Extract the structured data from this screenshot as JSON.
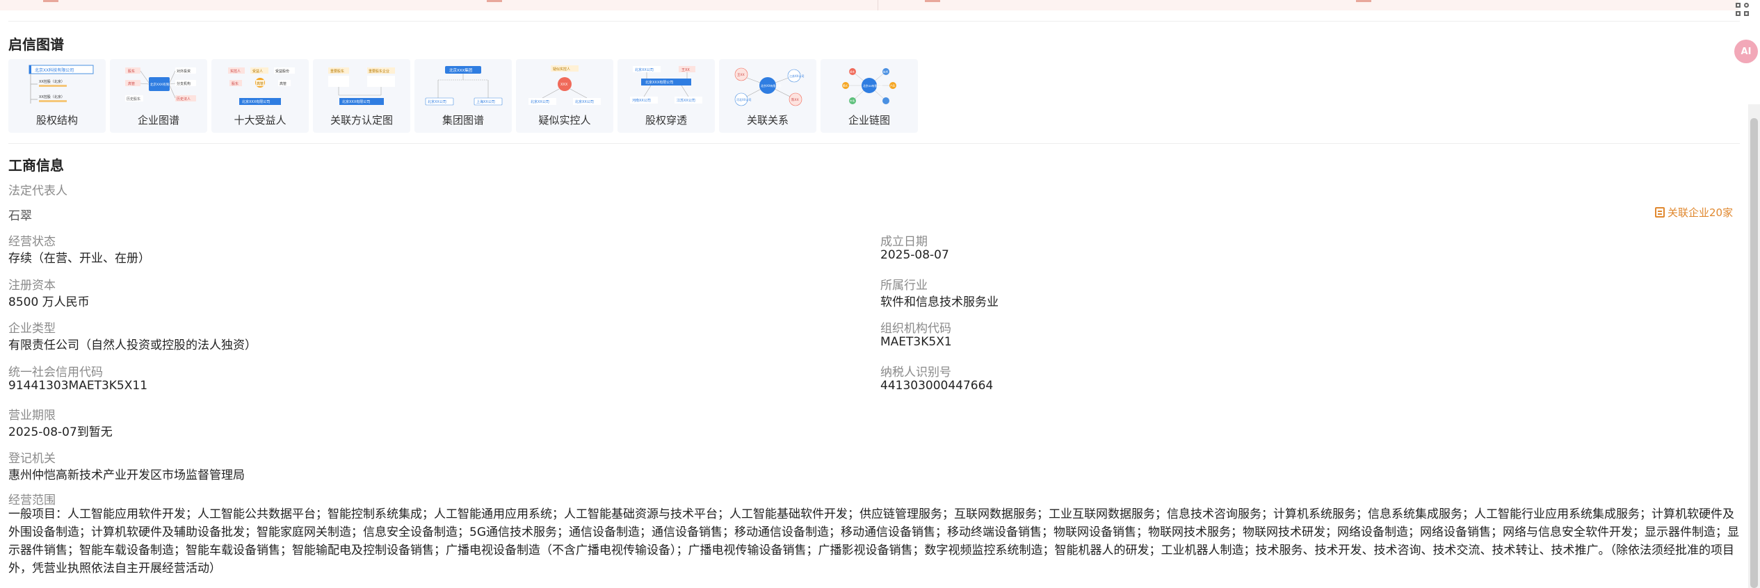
{
  "graphs": {
    "title": "启信图谱",
    "items": [
      {
        "label": "股权结构"
      },
      {
        "label": "企业图谱"
      },
      {
        "label": "十大受益人"
      },
      {
        "label": "关联方认定图"
      },
      {
        "label": "集团图谱"
      },
      {
        "label": "疑似实控人"
      },
      {
        "label": "股权穿透"
      },
      {
        "label": "关联关系"
      },
      {
        "label": "企业链图"
      }
    ]
  },
  "business": {
    "title": "工商信息",
    "legal_rep_label": "法定代表人",
    "legal_rep": "石翠",
    "related_companies": "关联企业20家",
    "status_label": "经营状态",
    "status": "存续（在营、开业、在册）",
    "founded_label": "成立日期",
    "founded": "2025-08-07",
    "capital_label": "注册资本",
    "capital": "8500 万人民币",
    "industry_label": "所属行业",
    "industry": "软件和信息技术服务业",
    "type_label": "企业类型",
    "type": "有限责任公司（自然人投资或控股的法人独资）",
    "org_code_label": "组织机构代码",
    "org_code": "MAET3K5X1",
    "credit_code_label": "统一社会信用代码",
    "credit_code": "91441303MAET3K5X11",
    "taxpayer_label": "纳税人识别号",
    "taxpayer": "441303000447664",
    "term_label": "营业期限",
    "term": "2025-08-07到暂无",
    "authority_label": "登记机关",
    "authority": "惠州仲恺高新技术产业开发区市场监督管理局",
    "scope_label": "经营范围",
    "scope": "一般项目：人工智能应用软件开发；人工智能公共数据平台；智能控制系统集成；人工智能通用应用系统；人工智能基础资源与技术平台；人工智能基础软件开发；供应链管理服务；互联网数据服务；工业互联网数据服务；信息技术咨询服务；计算机系统服务；信息系统集成服务；人工智能行业应用系统集成服务；计算机软硬件及外围设备制造；计算机软硬件及辅助设备批发；智能家庭网关制造；信息安全设备制造；5G通信技术服务；通信设备制造；通信设备销售；移动通信设备制造；移动通信设备销售；移动终端设备销售；物联网设备销售；物联网技术服务；物联网技术研发；网络设备制造；网络设备销售；网络与信息安全软件开发；显示器件制造；显示器件销售；智能车载设备制造；智能车载设备销售；智能输配电及控制设备销售；广播电视设备制造（不含广播电视传输设备）；广播电视传输设备销售；广播影视设备销售；数字视频监控系统制造；智能机器人的研发；工业机器人制造；技术服务、技术开发、技术咨询、技术交流、技术转让、技术推广。（除依法须经批准的项目外，凭营业执照依法自主开展经营活动）"
  },
  "side": {
    "avatar_text": "AI"
  },
  "thumb_text": {
    "t1": [
      "北京XX科技有限公司",
      "XX控股（北京）",
      "XX控股（北京）"
    ],
    "t2": [
      "股东",
      "高管",
      "北京XXX有限公司",
      "对外投资",
      "分支机构",
      "历史股东",
      "历史法人"
    ],
    "t3": [
      "实控人",
      "受益人",
      "受益股份",
      "股东",
      "高管",
      "高管",
      "北京XXX有限公司"
    ],
    "t4": [
      "重要股东",
      "重要股东企业",
      "北京XXX有限公司"
    ],
    "t5": [
      "北京XXX集团",
      "北京XX公司",
      "上海XX公司"
    ],
    "t6": [
      "疑似实控人",
      "XXX",
      "北京XX公司",
      "北京XX公司"
    ],
    "t7": [
      "北京XX公司",
      "王XX",
      "北京XXX有限公司",
      "河南XX公司",
      "江苏XX公司"
    ],
    "t8": [
      "王XX",
      "北京XX有限公司",
      "江苏XX公司",
      "河北XX公司",
      "陈XX"
    ],
    "t9": [
      "北京XX有限公司",
      "成本",
      "技术",
      "模式",
      "产品",
      "市场"
    ]
  }
}
